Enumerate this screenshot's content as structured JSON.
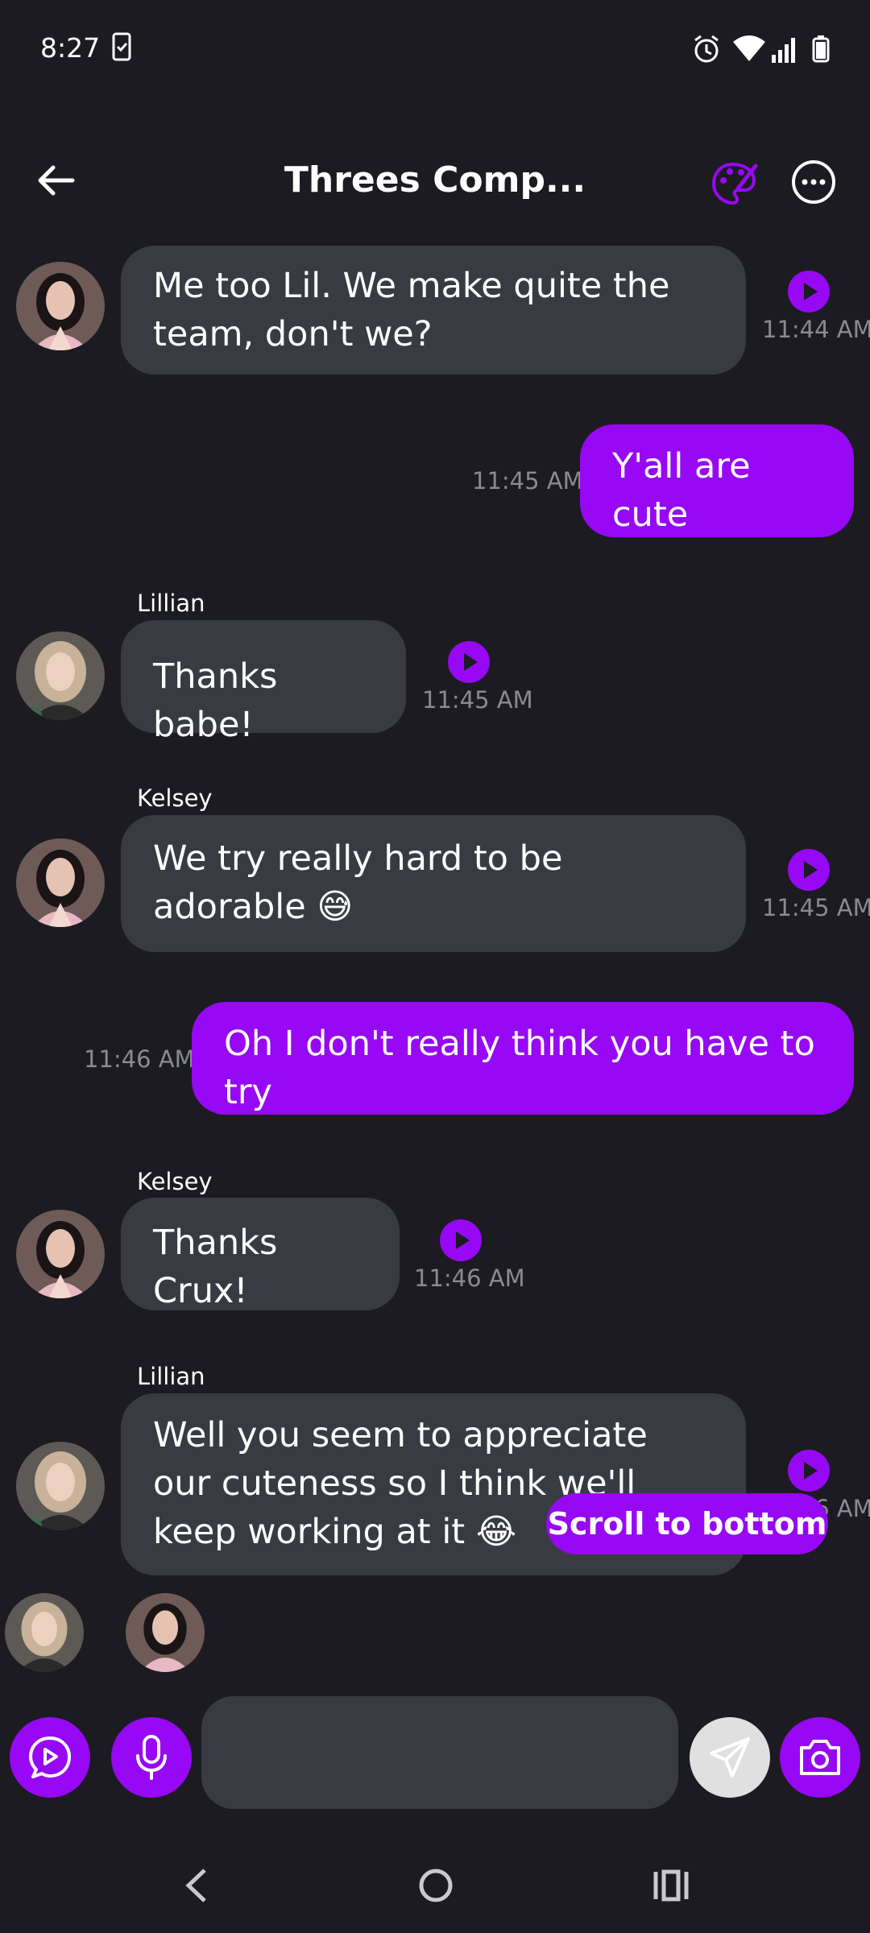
{
  "status_bar": {
    "time": "8:27"
  },
  "header": {
    "title": "Threes Comp..."
  },
  "messages": [
    {
      "sender": "",
      "text": "Me too Lil. We make quite the team, don't we?",
      "time": "11:44 AM",
      "direction": "in"
    },
    {
      "sender": "",
      "text": "Y'all are cute",
      "time": "11:45 AM",
      "direction": "out"
    },
    {
      "sender": "Lillian",
      "text": "Thanks babe!",
      "time": "11:45 AM",
      "direction": "in"
    },
    {
      "sender": "Kelsey",
      "text": "We try really hard to be adorable 😅",
      "time": "11:45 AM",
      "direction": "in"
    },
    {
      "sender": "",
      "text": "Oh I don't really think you have to try",
      "time": "11:46 AM",
      "direction": "out"
    },
    {
      "sender": "Kelsey",
      "text": "Thanks Crux!",
      "time": "11:46 AM",
      "direction": "in"
    },
    {
      "sender": "Lillian",
      "text": "Well you seem to appreciate our cuteness so I think we'll keep working at it 😂",
      "time": "11:46 AM",
      "direction": "in"
    }
  ],
  "scroll_to_bottom_label": "Scroll to bottom",
  "composer": {
    "placeholder": ""
  },
  "colors": {
    "accent": "#9708f5",
    "background": "#1b1b21",
    "bubble_in": "#393b43"
  }
}
